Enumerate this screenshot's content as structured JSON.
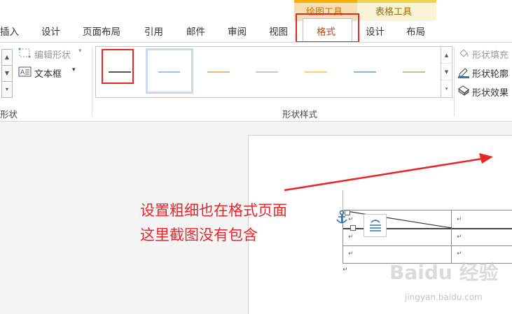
{
  "context_tabs": {
    "drawing_tools": "绘图工具",
    "table_tools": "表格工具"
  },
  "tabs": [
    "插入",
    "设计",
    "页面布局",
    "引用",
    "邮件",
    "审阅",
    "视图",
    "格式",
    "设计",
    "布局"
  ],
  "ribbon": {
    "edit_shape": "编辑形状",
    "text_box": "文本框",
    "shape_fill": "形状填充",
    "shape_outline": "形状轮廓",
    "shape_effects": "形状效果",
    "group_shapes_partial": "形状",
    "group_shape_styles": "形状样式"
  },
  "style_colors": [
    "#555555",
    "#9dc3e6",
    "#f4b183",
    "#c9c9c9",
    "#ffd36b",
    "#8fb3e0",
    "#a9d18e"
  ],
  "annotation": {
    "line1": "设置粗细也在格式页面",
    "line2": "这里截图没有包含"
  },
  "cell_mark": "↵",
  "watermark": {
    "logo": "Baidu 经验",
    "url": "jingyan.baidu.com"
  },
  "colors": {
    "accent_red": "#e8262a",
    "format_tab": "#c24a1a",
    "drawing_tools": "#f5b000",
    "table_tools": "#f1d44a"
  }
}
